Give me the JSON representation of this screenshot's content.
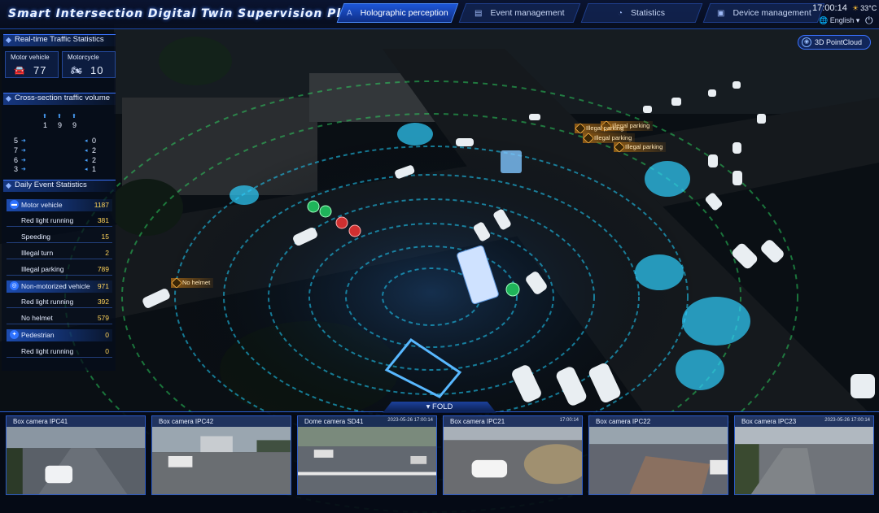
{
  "app": {
    "title": "Smart Intersection Digital Twin Supervision Platform",
    "time": "17:00:14",
    "temperature": "33°C",
    "language": "English",
    "language_caret": "▾"
  },
  "nav": [
    {
      "label": "Holographic perception",
      "icon": "A",
      "active": true
    },
    {
      "label": "Event management",
      "icon": "▤",
      "active": false
    },
    {
      "label": "Statistics",
      "icon": "◔",
      "active": false
    },
    {
      "label": "Device management",
      "icon": "▣",
      "active": false
    }
  ],
  "realtime": {
    "title": "Real-time Traffic Statistics",
    "motor_label": "Motor vehicle",
    "motor_value": "77",
    "motorcycle_label": "Motorcycle",
    "motorcycle_value": "10"
  },
  "cross_section": {
    "title": "Cross-section traffic volume",
    "top": [
      "1",
      "9",
      "9"
    ],
    "left": [
      "5",
      "7",
      "6",
      "3"
    ],
    "right": [
      "0",
      "2",
      "2",
      "1"
    ]
  },
  "daily": {
    "title": "Daily Event Statistics",
    "rows": [
      {
        "type": "cat",
        "name": "Motor vehicle",
        "value": "1187",
        "icon": "▬"
      },
      {
        "type": "sub",
        "name": "Red light running",
        "value": "381"
      },
      {
        "type": "sub",
        "name": "Speeding",
        "value": "15"
      },
      {
        "type": "sub",
        "name": "Illegal turn",
        "value": "2"
      },
      {
        "type": "sub",
        "name": "Illegal parking",
        "value": "789"
      },
      {
        "type": "cat",
        "name": "Non-motorized vehicle",
        "value": "971",
        "icon": "◎"
      },
      {
        "type": "sub",
        "name": "Red light running",
        "value": "392"
      },
      {
        "type": "sub",
        "name": "No helmet",
        "value": "579"
      },
      {
        "type": "cat",
        "name": "Pedestrian",
        "value": "0",
        "icon": "✦"
      },
      {
        "type": "sub",
        "name": "Red light running",
        "value": "0"
      }
    ]
  },
  "map_tags": {
    "no_helmet": "No helmet",
    "parking_a": "Illegal parking",
    "parking_b": "Illegal parking",
    "parking_c": "Illegal parking",
    "parking_d": "Illegal parking"
  },
  "pointcloud_button": "3D PointCloud",
  "fold_label": "FOLD",
  "fold_caret": "▾",
  "cameras": [
    {
      "title": "Box camera IPC41",
      "timestamp": ""
    },
    {
      "title": "Box camera IPC42",
      "timestamp": ""
    },
    {
      "title": "Dome camera SD41",
      "timestamp": "2023-05-26 17:00:14"
    },
    {
      "title": "Box camera IPC21",
      "timestamp": "17:00:14"
    },
    {
      "title": "Box camera IPC22",
      "timestamp": ""
    },
    {
      "title": "Box camera IPC23",
      "timestamp": "2023-05-26 17:00:14"
    }
  ]
}
